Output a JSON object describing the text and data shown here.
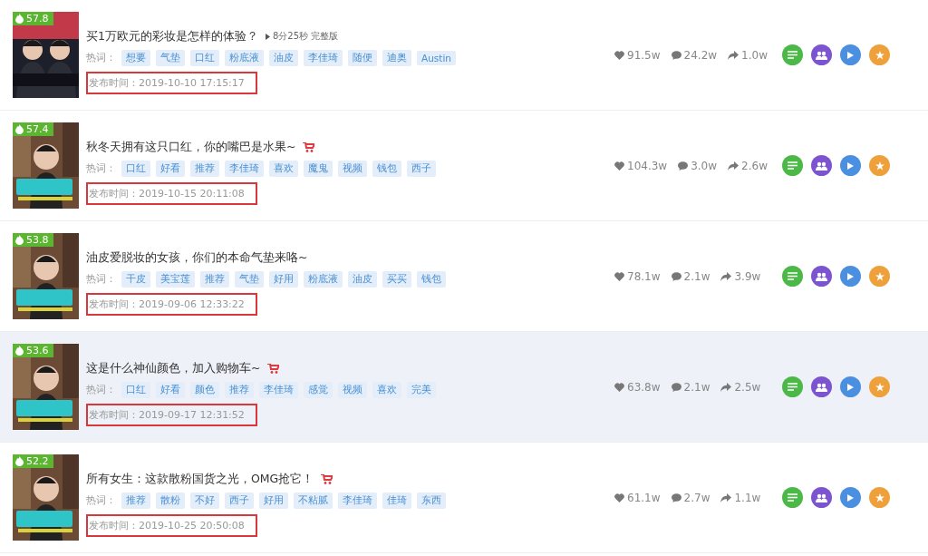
{
  "rows": [
    {
      "score": "57.8",
      "title": "买1万欧元的彩妆是怎样的体验？",
      "duration": "8分25秒",
      "duration_note": "完整版",
      "cart": false,
      "highlighted": false,
      "tags_label": "热词：",
      "tags": [
        "想要",
        "气垫",
        "口红",
        "粉底液",
        "油皮",
        "李佳琦",
        "随便",
        "迪奥",
        "Austin"
      ],
      "date": "发布时间：2019-10-10 17:15:17",
      "date_marked": true,
      "likes": "91.5w",
      "comments": "24.2w",
      "shares": "1.0w"
    },
    {
      "score": "57.4",
      "title": "秋冬天拥有这只口红，你的嘴巴是水果~",
      "cart": true,
      "highlighted": false,
      "tags_label": "热词：",
      "tags": [
        "口红",
        "好看",
        "推荐",
        "李佳琦",
        "喜欢",
        "魔鬼",
        "视频",
        "钱包",
        "西子"
      ],
      "date": "发布时间：2019-10-15 20:11:08",
      "date_marked": true,
      "likes": "104.3w",
      "comments": "3.0w",
      "shares": "2.6w"
    },
    {
      "score": "53.8",
      "title": "油皮爱脱妆的女孩，你们的本命气垫来咯~",
      "cart": false,
      "highlighted": false,
      "tags_label": "热词：",
      "tags": [
        "干皮",
        "美宝莲",
        "推荐",
        "气垫",
        "好用",
        "粉底液",
        "油皮",
        "买买",
        "钱包"
      ],
      "date": "发布时间：2019-09-06 12:33:22",
      "date_marked": true,
      "likes": "78.1w",
      "comments": "2.1w",
      "shares": "3.9w"
    },
    {
      "score": "53.6",
      "title": "这是什么神仙颜色，加入购物车~",
      "cart": true,
      "highlighted": true,
      "tags_label": "热词：",
      "tags": [
        "口红",
        "好看",
        "颜色",
        "推荐",
        "李佳琦",
        "感觉",
        "视频",
        "喜欢",
        "完美"
      ],
      "date": "发布时间：2019-09-17 12:31:52",
      "date_marked": true,
      "likes": "63.8w",
      "comments": "2.1w",
      "shares": "2.5w"
    },
    {
      "score": "52.2",
      "title": "所有女生：这款散粉国货之光，OMG抢它！",
      "cart": true,
      "highlighted": false,
      "tags_label": "热词：",
      "tags": [
        "推荐",
        "散粉",
        "不好",
        "西子",
        "好用",
        "不粘腻",
        "李佳琦",
        "佳琦",
        "东西"
      ],
      "date": "发布时间：2019-10-25 20:50:08",
      "date_marked": true,
      "likes": "61.1w",
      "comments": "2.7w",
      "shares": "1.1w"
    }
  ]
}
